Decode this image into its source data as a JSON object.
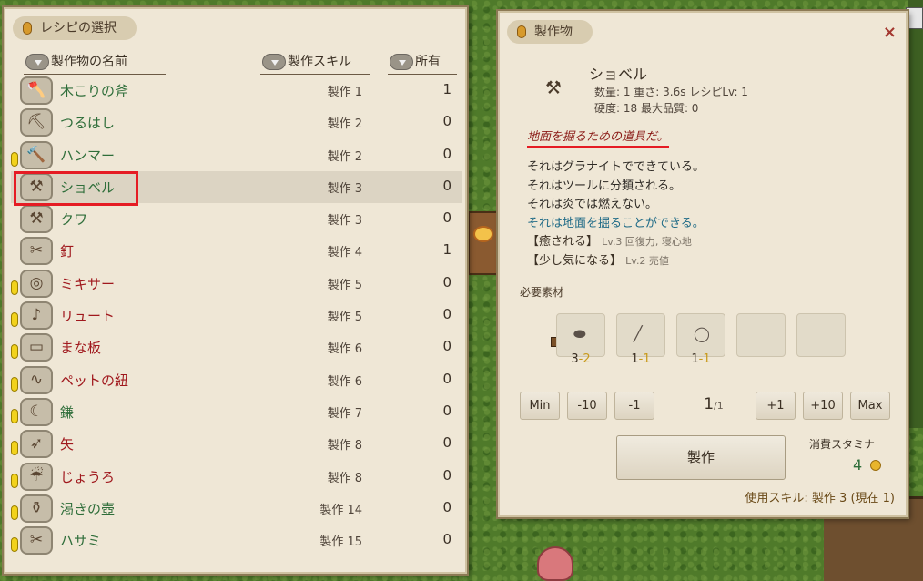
{
  "recipe_panel": {
    "title": "レシピの選択",
    "columns": {
      "name": "製作物の名前",
      "skill": "製作スキル",
      "owned": "所有"
    },
    "items": [
      {
        "name": "木こりの斧",
        "skill": "製作 1",
        "owned": "1",
        "icon": "axe-icon",
        "glyph": "🪓",
        "red": false,
        "warn": false
      },
      {
        "name": "つるはし",
        "skill": "製作 2",
        "owned": "0",
        "icon": "pickaxe-icon",
        "glyph": "⛏",
        "red": false,
        "warn": false
      },
      {
        "name": "ハンマー",
        "skill": "製作 2",
        "owned": "0",
        "icon": "hammer-icon",
        "glyph": "🔨",
        "red": false,
        "warn": true
      },
      {
        "name": "ショベル",
        "skill": "製作 3",
        "owned": "0",
        "icon": "shovel-icon",
        "glyph": "⚒",
        "red": false,
        "warn": false,
        "selected": true
      },
      {
        "name": "クワ",
        "skill": "製作 3",
        "owned": "0",
        "icon": "hoe-icon",
        "glyph": "⚒",
        "red": false,
        "warn": false
      },
      {
        "name": "釘",
        "skill": "製作 4",
        "owned": "1",
        "icon": "nail-icon",
        "glyph": "✂",
        "red": true,
        "warn": false
      },
      {
        "name": "ミキサー",
        "skill": "製作 5",
        "owned": "0",
        "icon": "mixer-icon",
        "glyph": "◎",
        "red": true,
        "warn": true
      },
      {
        "name": "リュート",
        "skill": "製作 5",
        "owned": "0",
        "icon": "lute-icon",
        "glyph": "♪",
        "red": true,
        "warn": true
      },
      {
        "name": "まな板",
        "skill": "製作 6",
        "owned": "0",
        "icon": "cutting-board-icon",
        "glyph": "▭",
        "red": true,
        "warn": true
      },
      {
        "name": "ペットの紐",
        "skill": "製作 6",
        "owned": "0",
        "icon": "leash-icon",
        "glyph": "∿",
        "red": true,
        "warn": true
      },
      {
        "name": "鎌",
        "skill": "製作 7",
        "owned": "0",
        "icon": "sickle-icon",
        "glyph": "☾",
        "red": false,
        "warn": true
      },
      {
        "name": "矢",
        "skill": "製作 8",
        "owned": "0",
        "icon": "arrow-icon",
        "glyph": "➶",
        "red": true,
        "warn": true
      },
      {
        "name": "じょうろ",
        "skill": "製作 8",
        "owned": "0",
        "icon": "watering-can-icon",
        "glyph": "☔",
        "red": true,
        "warn": true
      },
      {
        "name": "渇きの壺",
        "skill": "製作 14",
        "owned": "0",
        "icon": "jar-icon",
        "glyph": "⚱",
        "red": false,
        "warn": true
      },
      {
        "name": "ハサミ",
        "skill": "製作 15",
        "owned": "0",
        "icon": "scissors-icon",
        "glyph": "✂",
        "red": false,
        "warn": true
      }
    ]
  },
  "detail_panel": {
    "title": "製作物",
    "close_glyph": "×",
    "item": {
      "name": "ショベル",
      "stats_line1": "数量: 1  重さ: 3.6s  レシピLv: 1",
      "stats_line2": "硬度: 18  最大品質: 0",
      "flavor": "地面を掘るための道具だ。",
      "desc": [
        "それはグラナイトでできている。",
        "それはツールに分類される。",
        "それは炎では燃えない。"
      ],
      "desc_blue": "それは地面を掘ることができる。",
      "enchants": [
        {
          "name": "【癒される】",
          "detail": "Lv.3 回復力, 寝心地"
        },
        {
          "name": "【少し気になる】",
          "detail": "Lv.2 売値"
        }
      ]
    },
    "materials_title": "必要素材",
    "materials": [
      {
        "icon": "stone-icon",
        "glyph": "⬬",
        "have": "3",
        "need": "-2"
      },
      {
        "icon": "stick-icon",
        "glyph": "╱",
        "have": "1",
        "need": "-1"
      },
      {
        "icon": "ring-icon",
        "glyph": "◯",
        "have": "1",
        "need": "-1"
      }
    ],
    "quantity_buttons": {
      "min": "Min",
      "minus10": "-10",
      "minus1": "-1",
      "plus1": "+1",
      "plus10": "+10",
      "max": "Max"
    },
    "quantity": {
      "current": "1",
      "max": "/1"
    },
    "craft_label": "製作",
    "stamina_label": "消費スタミナ",
    "stamina_value": "4",
    "skill_footer": "使用スキル: 製作 3 (現在 1)"
  }
}
